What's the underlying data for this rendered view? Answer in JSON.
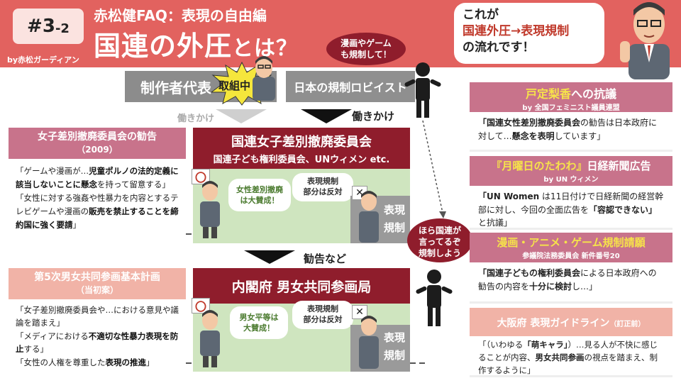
{
  "header": {
    "badge_main": "#3",
    "badge_sub": "-2",
    "author": "by赤松ガーディアン",
    "series_title": "赤松健FAQ：表現の自由編",
    "title_main": "国連の外圧",
    "title_tail": "とは？"
  },
  "top_speech": {
    "line1": "これが",
    "line2": "国連外圧→表現規制",
    "line3": "の流れです！"
  },
  "lobbyist_speech": {
    "line1": "漫画やゲーム",
    "line2": "も規制して！"
  },
  "creator_rep": {
    "label": "制作者代表",
    "badge": "取組中"
  },
  "lobbyist": {
    "label": "日本の規制ロビイスト"
  },
  "arrows": {
    "left_label": "働きかけ",
    "right_label": "働きかけ",
    "middle_label": "勧告など"
  },
  "un_box": {
    "title": "国連女子差別撤廃委員会",
    "subtitle": "国連子ども権利委員会、UNウィメン etc."
  },
  "un_panel": {
    "circle": "〇",
    "bubble_line1": "女性差別撤廃",
    "bubble_line2": "は大賛成！",
    "oppose_line1": "表現規制",
    "oppose_line2": "部分は反対",
    "cross": "✕",
    "regulation_line1": "表現",
    "regulation_line2": "規制"
  },
  "cabinet_box": {
    "title": "内閣府 男女共同参画局"
  },
  "cabinet_panel": {
    "circle": "〇",
    "bubble_line1": "男女平等は",
    "bubble_line2": "大賛成！",
    "oppose_line1": "表現規制",
    "oppose_line2": "部分は反対",
    "cross": "✕",
    "regulation_line1": "表現",
    "regulation_line2": "規制"
  },
  "center_speech": {
    "line1": "ほら国連が",
    "line2": "言ってるぞ",
    "line3": "規制しよう"
  },
  "left_card_1": {
    "title": "女子差別撤廃委員会の勧告",
    "year": "（2009）",
    "p1_a": "「ゲームや漫画が…",
    "p1_b": "児童ポルノの法的定義に該当しないことに懸念",
    "p1_c": "を持って留意する」",
    "p2_a": "「女性に対する強姦や性暴力を内容とするテレビゲームや漫画の",
    "p2_b": "販売を禁止することを締約国に強く要請",
    "p2_c": "」"
  },
  "left_card_2": {
    "title": "第5次男女共同参画基本計画",
    "subtitle": "（当初案）",
    "p1": "「女子差別撤廃委員会や…における意見や議論を踏まえ」",
    "p2_a": "「メディアにおける",
    "p2_b": "不適切な性暴力表現を防止",
    "p2_c": "する」",
    "p3_a": "「女性の人権を尊重した",
    "p3_b": "表現の推進",
    "p3_c": "」"
  },
  "right_card_1": {
    "title_a": "戸定梨香",
    "title_b": "への抗議",
    "by": "by 全国フェミニスト議員連盟",
    "body_a": "「国連女性差別撤廃委員会",
    "body_b": "の勧告は日本政府に対して…",
    "body_c": "懸念を表明",
    "body_d": "しています」"
  },
  "right_card_2": {
    "title_a": "『月曜日のたわわ』",
    "title_b": "日経新聞広告",
    "by": "by UN ウィメン",
    "body_a": "「UN Women",
    "body_b": " は11日付けで日経新聞の経営幹部に対し、今回の全面広告を",
    "body_c": "「容認できない」",
    "body_d": "と抗議」"
  },
  "right_card_3": {
    "title": "漫画・アニメ・ゲーム規制請願",
    "sub": "参議院法務委員会 新件番号20",
    "body_a": "「国連子どもの権利委員会",
    "body_b": "による日本政府への勧告の内容を",
    "body_c": "十分に検討",
    "body_d": "し…」"
  },
  "right_card_4": {
    "title": "大阪府 表現ガイドライン",
    "title_small": "（訂正前）",
    "body_a": "「（いわゆる",
    "body_b": "「萌キャラ」",
    "body_c": "）…見る人が不快に感じることが内容、",
    "body_d": "男女共同参画",
    "body_e": "の視点を踏まえ、制作するように」"
  },
  "colors": {
    "header_red": "#e2625f",
    "dark_red": "#8f1d2c",
    "rose": "#c8738b",
    "salmon": "#f1b3a7",
    "green_panel": "#cfe5bf",
    "yellow_highlight": "#f6e34a"
  }
}
